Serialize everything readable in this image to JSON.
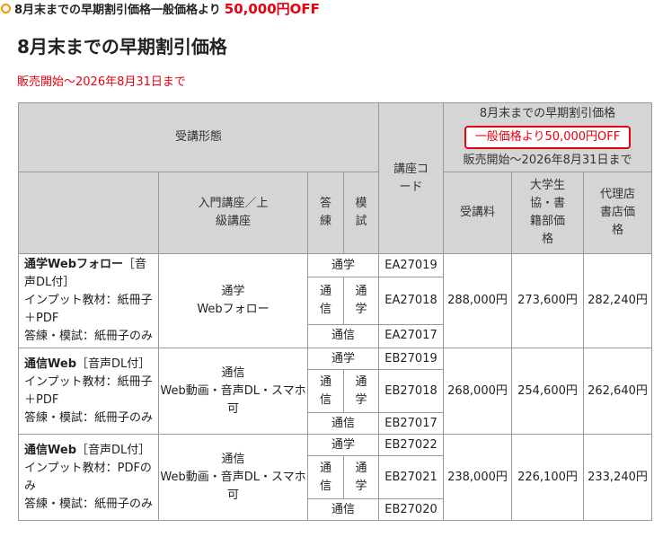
{
  "promo": {
    "text": "8月末までの早期割引価格一般価格より",
    "amount": "50,000円OFF"
  },
  "page_title": "8月末までの早期割引価格",
  "period": "販売開始～2026年8月31日まで",
  "table": {
    "headers": {
      "format": "受講形態",
      "course_level": "入門講座／上級講座",
      "answer_practice": "答練",
      "mock_exam": "模試",
      "course_code": "講座コード",
      "early_price_title": "8月末までの早期割引価格",
      "discount_badge": "一般価格より50,000円OFF",
      "early_price_period": "販売開始～2026年8月31日まで",
      "fee": "受講料",
      "univ_coop": "大学生協・書籍部価格",
      "agency": "代理店書店価格"
    },
    "rows": [
      {
        "name": "通学Webフォロー",
        "name_suffix": "［音声DL付］",
        "material_line": "インプット教材：紙冊子＋PDF",
        "exam_line": "答練・模試：紙冊子のみ",
        "mode_line1": "通学",
        "mode_line2": "Webフォロー",
        "opt1_label": "通学",
        "opt2_left": "通信",
        "opt2_right": "通学",
        "opt3_label": "通信",
        "code1": "EA27019",
        "code2": "EA27018",
        "code3": "EA27017",
        "fee": "288,000円",
        "univ": "273,600円",
        "agency": "282,240円"
      },
      {
        "name": "通信Web",
        "name_suffix": "［音声DL付］",
        "material_line": "インプット教材：紙冊子＋PDF",
        "exam_line": "答練・模試：紙冊子のみ",
        "mode_line1": "通信",
        "mode_line2": "Web動画・音声DL・スマホ可",
        "opt1_label": "通学",
        "opt2_left": "通信",
        "opt2_right": "通学",
        "opt3_label": "通信",
        "code1": "EB27019",
        "code2": "EB27018",
        "code3": "EB27017",
        "fee": "268,000円",
        "univ": "254,600円",
        "agency": "262,640円"
      },
      {
        "name": "通信Web",
        "name_suffix": "［音声DL付］",
        "material_line": "インプット教材：PDFのみ",
        "exam_line": "答練・模試：紙冊子のみ",
        "mode_line1": "通信",
        "mode_line2": "Web動画・音声DL・スマホ可",
        "opt1_label": "通学",
        "opt2_left": "通信",
        "opt2_right": "通学",
        "opt3_label": "通信",
        "code1": "EB27022",
        "code2": "EB27021",
        "code3": "EB27020",
        "fee": "238,000円",
        "univ": "226,100円",
        "agency": "233,240円"
      }
    ]
  }
}
